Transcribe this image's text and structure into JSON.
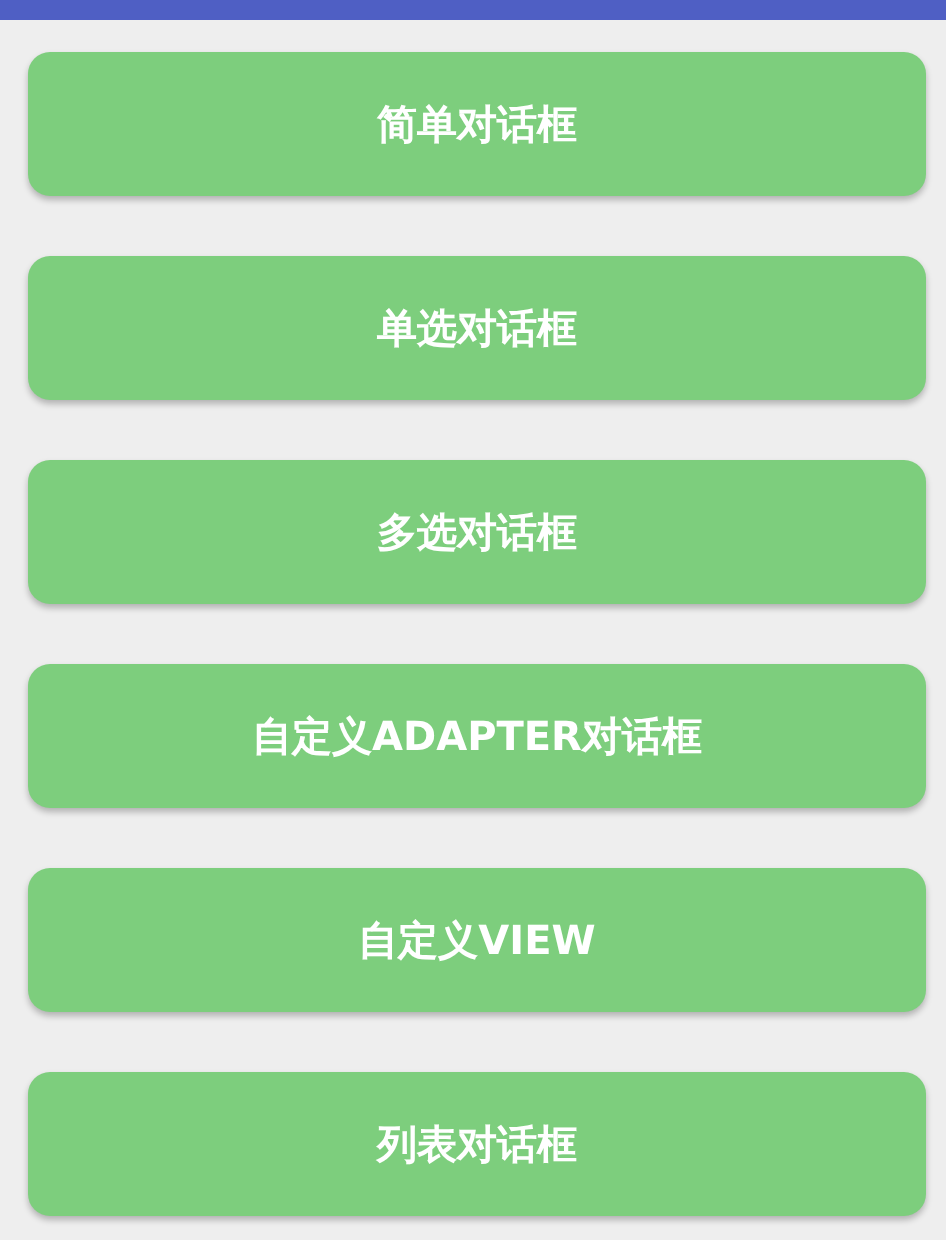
{
  "buttons": [
    {
      "label": "简单对话框"
    },
    {
      "label": "单选对话框"
    },
    {
      "label": "多选对话框"
    },
    {
      "label": "自定义ADAPTER对话框"
    },
    {
      "label": "自定义VIEW"
    },
    {
      "label": "列表对话框"
    }
  ]
}
